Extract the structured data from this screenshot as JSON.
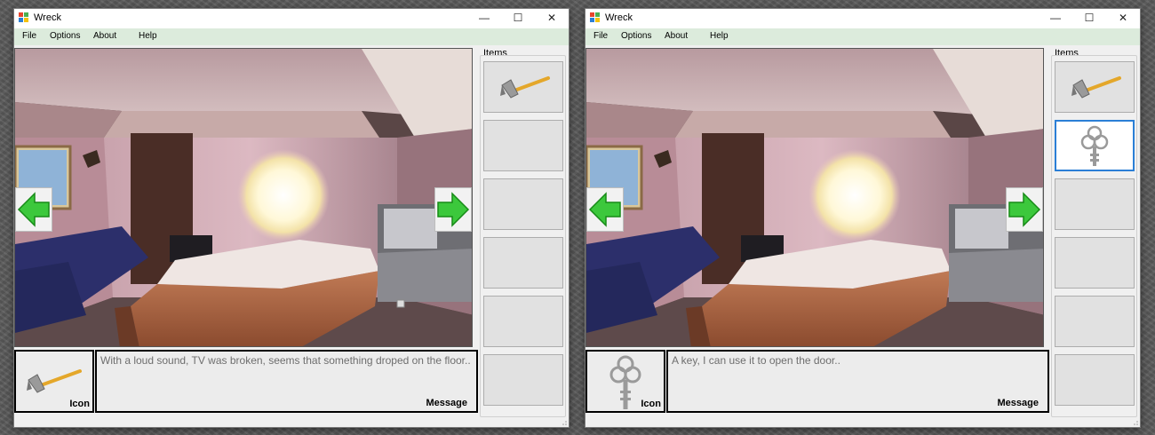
{
  "windows": [
    {
      "title": "Wreck",
      "menu": [
        "File",
        "Options",
        "About",
        "Help"
      ],
      "window_controls": {
        "minimize": "—",
        "maximize": "☐",
        "close": "✕"
      },
      "items_label": "Items",
      "inventory": [
        "hammer",
        "",
        "",
        "",
        "",
        ""
      ],
      "selected_slot": null,
      "icon_caption": "Icon",
      "current_icon": "hammer",
      "message": "With a loud sound, TV was broken, seems that something droped on the floor..",
      "message_caption": "Message",
      "scene": "bedroom"
    },
    {
      "title": "Wreck",
      "menu": [
        "File",
        "Options",
        "About",
        "Help"
      ],
      "window_controls": {
        "minimize": "—",
        "maximize": "☐",
        "close": "✕"
      },
      "items_label": "Items",
      "inventory": [
        "hammer",
        "key",
        "",
        "",
        "",
        ""
      ],
      "selected_slot": 1,
      "icon_caption": "Icon",
      "current_icon": "key",
      "message": "A key, I can use it to open the door..",
      "message_caption": "Message",
      "scene": "bedroom"
    }
  ],
  "colors": {
    "menubar": "#dcebdc",
    "arrow": "#3cc83c",
    "selection": "#2b7fd6",
    "message_text": "#6e6e6e"
  }
}
